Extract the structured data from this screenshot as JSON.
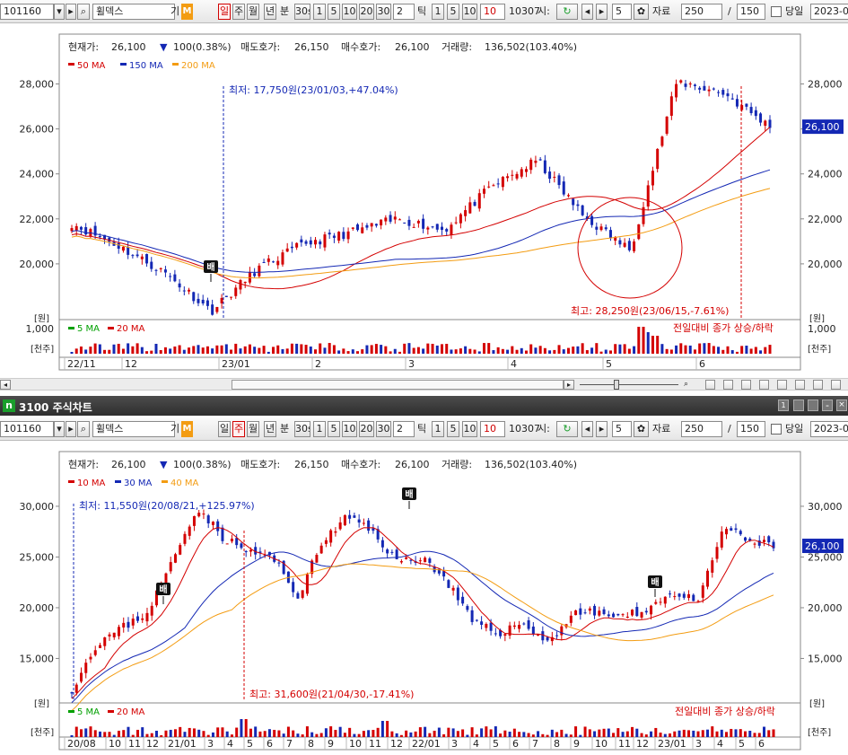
{
  "toolbar": {
    "code": "101160",
    "name": "휠덱스",
    "gi_label": "기",
    "m_label": "M",
    "period_day": "일",
    "period_week": "주",
    "period_month": "월",
    "period_year": "년",
    "period_min": "분",
    "period_30s": "30s",
    "nums": [
      "1",
      "5",
      "10",
      "20",
      "30"
    ],
    "tick_value": "2",
    "tick_label": "틱",
    "tick_nums": [
      "1",
      "5",
      "10"
    ],
    "tick_red": "10",
    "code2": "10307",
    "time_label": "시:",
    "refresh_icon": "refresh-icon",
    "step_value": "5",
    "gear_icon": "gear-icon",
    "data_label": "자료",
    "data_value": "250",
    "slash": "/",
    "data_total": "150",
    "today_label": "당일",
    "date_value": "2023-0"
  },
  "colors": {
    "up": "#d40000",
    "down": "#1428b4",
    "ma_red": "#d40000",
    "ma_blue": "#1428b4",
    "ma_orange": "#f39c12",
    "ma_green": "#00a000",
    "title_bg": "#3c3c3c",
    "price_tag": "#1428b4"
  },
  "info": {
    "current_label": "현재가:",
    "current_value": "26,100",
    "change_arrow": "▼",
    "change_value": "100(0.38%)",
    "ask_label": "매도호가:",
    "ask_value": "26,150",
    "bid_label": "매수호가:",
    "bid_value": "26,100",
    "volume_label": "거래량:",
    "volume_value": "136,502(103.40%)"
  },
  "chart1": {
    "legend": [
      {
        "label": "50 MA",
        "color": "#d40000"
      },
      {
        "label": "150 MA",
        "color": "#1428b4"
      },
      {
        "label": "200 MA",
        "color": "#f39c12"
      }
    ],
    "low_annotation": "최저: 17,750원(23/01/03,+47.04%)",
    "high_annotation": "최고: 28,250원(23/06/15,-7.61%)",
    "y_ticks": [
      "28,000",
      "26,000",
      "24,000",
      "22,000",
      "20,000"
    ],
    "unit_label": "[원]",
    "price_tag": "26,100",
    "badge": "배",
    "vol_legend": [
      {
        "label": "5 MA",
        "color": "#00a000"
      },
      {
        "label": "20 MA",
        "color": "#d40000"
      }
    ],
    "vol_note": "전일대비 종가 상승/하락",
    "vol_tick": "1,000",
    "vol_unit": "[천주]",
    "x_labels": [
      "22/11",
      "12",
      "23/01",
      "2",
      "3",
      "4",
      "5",
      "6"
    ]
  },
  "chart2": {
    "title": "3100 주식차트",
    "title_icon": "n",
    "legend": [
      {
        "label": "10 MA",
        "color": "#d40000"
      },
      {
        "label": "30 MA",
        "color": "#1428b4"
      },
      {
        "label": "40 MA",
        "color": "#f39c12"
      }
    ],
    "low_annotation": "최저: 11,550원(20/08/21,+125.97%)",
    "high_annotation": "최고: 31,600원(21/04/30,-17.41%)",
    "y_ticks": [
      "30,000",
      "25,000",
      "20,000",
      "15,000"
    ],
    "unit_label": "[원]",
    "price_tag": "26,100",
    "badge": "배",
    "vol_legend": [
      {
        "label": "5 MA",
        "color": "#00a000"
      },
      {
        "label": "20 MA",
        "color": "#d40000"
      }
    ],
    "vol_note": "전일대비 종가 상승/하락",
    "vol_unit": "[천주]",
    "x_labels": [
      "20/08",
      "10",
      "11",
      "12",
      "21/01",
      "3",
      "4",
      "5",
      "6",
      "7",
      "8",
      "9",
      "10",
      "11",
      "12",
      "22/01",
      "3",
      "4",
      "5",
      "6",
      "7",
      "8",
      "9",
      "10",
      "11",
      "12",
      "23/01",
      "3",
      "4",
      "5",
      "6"
    ]
  },
  "chart_data": [
    {
      "type": "line",
      "title": "",
      "series": [
        {
          "name": "50 MA"
        },
        {
          "name": "150 MA"
        },
        {
          "name": "200 MA"
        }
      ],
      "x_labels": [
        "22/11",
        "12",
        "23/01",
        "2",
        "3",
        "4",
        "5",
        "6"
      ],
      "ylim": [
        18000,
        28500
      ],
      "close_approx": [
        21800,
        20800,
        19600,
        17900,
        19800,
        20900,
        21400,
        22000,
        21500,
        23400,
        24600,
        22100,
        20600,
        28100,
        27600,
        26100
      ],
      "high": 28250,
      "low": 17750,
      "current": 26100
    },
    {
      "type": "line",
      "title": "",
      "series": [
        {
          "name": "10 MA"
        },
        {
          "name": "30 MA"
        },
        {
          "name": "40 MA"
        }
      ],
      "x_labels": [
        "20/08",
        "10",
        "11",
        "12",
        "21/01",
        "3",
        "4",
        "5",
        "6",
        "7",
        "8",
        "9",
        "10",
        "11",
        "12",
        "22/01",
        "3",
        "4",
        "5",
        "6",
        "7",
        "8",
        "9",
        "10",
        "11",
        "12",
        "23/01",
        "3",
        "4",
        "5",
        "6"
      ],
      "ylim": [
        11000,
        32000
      ],
      "close_approx": [
        12000,
        16500,
        18000,
        19500,
        24500,
        30000,
        27000,
        25500,
        25000,
        21000,
        26500,
        29000,
        27500,
        24500,
        25000,
        22500,
        18500,
        17500,
        18500,
        16500,
        19500,
        19500,
        19000,
        20000,
        21500,
        20500,
        28000,
        26500,
        26100
      ],
      "high": 31600,
      "low": 11550,
      "current": 26100
    }
  ]
}
